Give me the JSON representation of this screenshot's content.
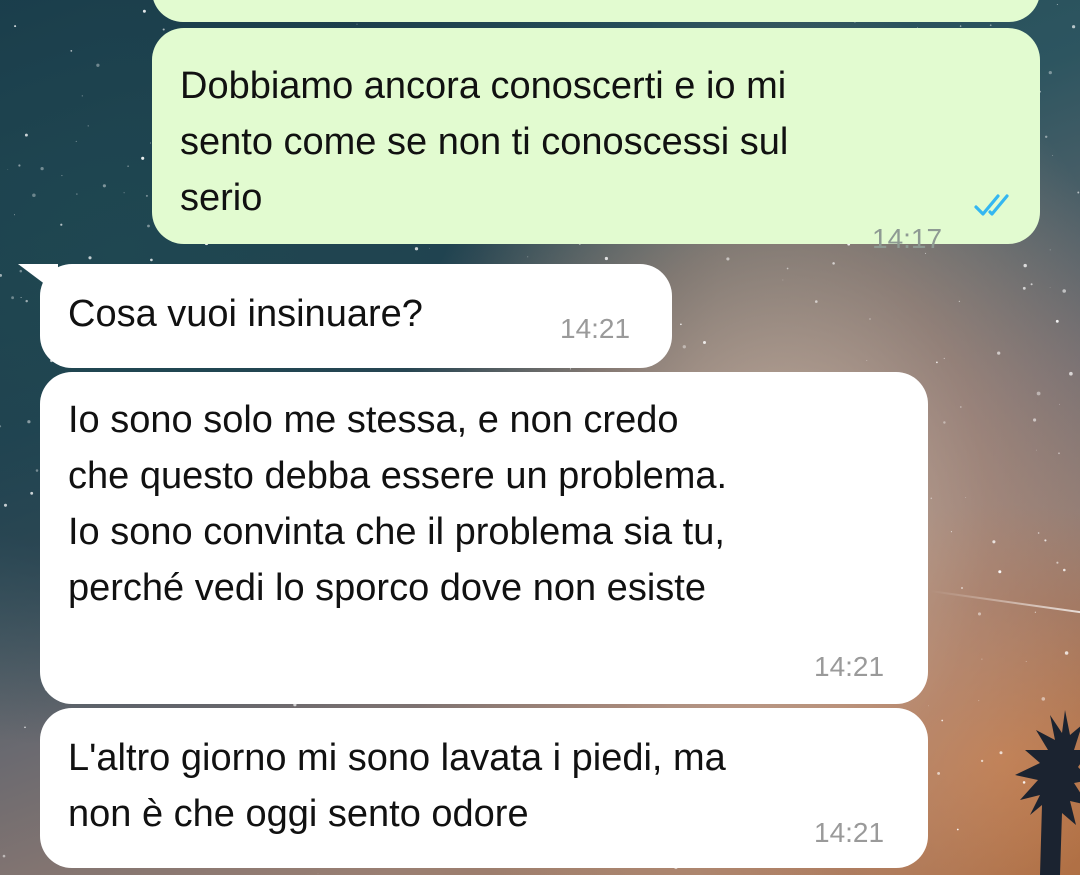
{
  "messages": [
    {
      "id": "m0",
      "direction": "outgoing",
      "text": "",
      "time": ""
    },
    {
      "id": "m1",
      "direction": "outgoing",
      "text": "Dobbiamo ancora conoscerti e io mi\nsento come se non ti conoscessi sul\nserio",
      "time": "14:17",
      "status": "read"
    },
    {
      "id": "m2",
      "direction": "incoming",
      "text": "Cosa vuoi insinuare?",
      "time": "14:21"
    },
    {
      "id": "m3",
      "direction": "incoming",
      "text": "Io sono solo me stessa, e non credo\nche questo debba essere un problema.\nIo sono convinta che il problema sia tu,\nperché vedi lo sporco dove non esiste",
      "time": "14:21"
    },
    {
      "id": "m4",
      "direction": "incoming",
      "text": "L'altro giorno mi sono lavata i piedi, ma\nnon è che oggi sento odore",
      "time": "14:21"
    }
  ],
  "icons": {
    "read_receipt": "double-check-icon"
  },
  "colors": {
    "outgoing_bubble": "#e2fbd0",
    "incoming_bubble": "#ffffff",
    "read_tick": "#34b7f1",
    "timestamp": "#8e9a93"
  }
}
